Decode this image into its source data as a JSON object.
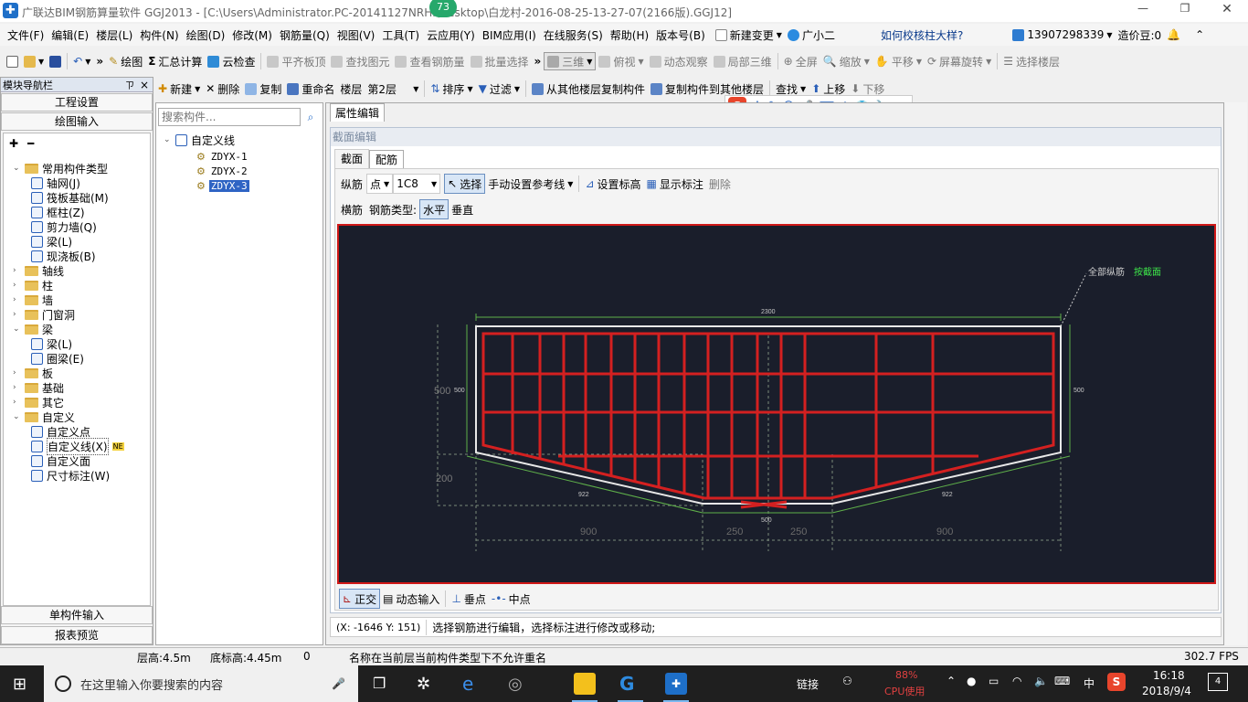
{
  "window": {
    "title": "广联达BIM钢筋算量软件 GGJ2013 - [C:\\Users\\Administrator.PC-20141127NRHI\\Desktop\\白龙村-2016-08-25-13-27-07(2166版).GGJ12]",
    "badge": "73"
  },
  "menu": {
    "items": [
      "文件(F)",
      "编辑(E)",
      "楼层(L)",
      "构件(N)",
      "绘图(D)",
      "修改(M)",
      "钢筋量(Q)",
      "视图(V)",
      "工具(T)",
      "云应用(Y)",
      "BIM应用(I)",
      "在线服务(S)",
      "帮助(H)",
      "版本号(B)"
    ],
    "new_change": "新建变更",
    "guangxiaoer": "广小二",
    "help_link": "如何校核柱大样?",
    "phone": "13907298339",
    "price_bean": "造价豆:0"
  },
  "toolbar1": {
    "draw": "绘图",
    "sum": "汇总计算",
    "cloud_check": "云检查",
    "flat_top": "平齐板顶",
    "find_elem": "查找图元",
    "view_rebar": "查看钢筋量",
    "batch_select": "批量选择",
    "view3d": "三维",
    "topview": "俯视",
    "dynamic": "动态观察",
    "partial3d": "局部三维",
    "fullscreen": "全屏",
    "zoom": "缩放",
    "pan": "平移",
    "rotate": "屏幕旋转",
    "select_floor": "选择楼层"
  },
  "nav": {
    "title": "模块导航栏",
    "pin": "ㄗ",
    "close": "×",
    "project_settings": "工程设置",
    "drawing_input": "绘图输入",
    "single_input": "单构件输入",
    "report": "报表预览",
    "tree": [
      {
        "label": "常用构件类型",
        "level": 0,
        "type": "folder",
        "open": true
      },
      {
        "label": "轴网(J)",
        "level": 1,
        "type": "item"
      },
      {
        "label": "筏板基础(M)",
        "level": 1,
        "type": "item"
      },
      {
        "label": "框柱(Z)",
        "level": 1,
        "type": "item"
      },
      {
        "label": "剪力墙(Q)",
        "level": 1,
        "type": "item"
      },
      {
        "label": "梁(L)",
        "level": 1,
        "type": "item"
      },
      {
        "label": "现浇板(B)",
        "level": 1,
        "type": "item"
      },
      {
        "label": "轴线",
        "level": 0,
        "type": "folder"
      },
      {
        "label": "柱",
        "level": 0,
        "type": "folder"
      },
      {
        "label": "墙",
        "level": 0,
        "type": "folder"
      },
      {
        "label": "门窗洞",
        "level": 0,
        "type": "folder"
      },
      {
        "label": "梁",
        "level": 0,
        "type": "folder",
        "open": true
      },
      {
        "label": "梁(L)",
        "level": 1,
        "type": "item"
      },
      {
        "label": "圈梁(E)",
        "level": 1,
        "type": "item"
      },
      {
        "label": "板",
        "level": 0,
        "type": "folder"
      },
      {
        "label": "基础",
        "level": 0,
        "type": "folder"
      },
      {
        "label": "其它",
        "level": 0,
        "type": "folder"
      },
      {
        "label": "自定义",
        "level": 0,
        "type": "folder",
        "open": true
      },
      {
        "label": "自定义点",
        "level": 1,
        "type": "item"
      },
      {
        "label": "自定义线(X)",
        "level": 1,
        "type": "item",
        "selected": true,
        "badge": "NE"
      },
      {
        "label": "自定义面",
        "level": 1,
        "type": "item"
      },
      {
        "label": "尺寸标注(W)",
        "level": 1,
        "type": "item"
      }
    ]
  },
  "comp_toolbar": {
    "new": "新建",
    "delete": "删除",
    "copy": "复制",
    "rename": "重命名",
    "floor_label": "楼层",
    "floor_value": "第2层",
    "sort": "排序",
    "filter": "过滤",
    "copy_from": "从其他楼层复制构件",
    "copy_to": "复制构件到其他楼层",
    "find": "查找",
    "up": "上移",
    "down": "下移"
  },
  "ime": {
    "s": "S",
    "zh": "中",
    "punct": "°,"
  },
  "components": {
    "search_placeholder": "搜索构件...",
    "root": "自定义线",
    "items": [
      "ZDYX-1",
      "ZDYX-2",
      "ZDYX-3"
    ],
    "selected_index": 2
  },
  "prop_tab": "属性编辑",
  "section_editor": {
    "title": "截面编辑",
    "tabs": [
      "截面",
      "配筋"
    ],
    "active_tab": "配筋",
    "row1": {
      "longitudinal": "纵筋",
      "point": "点",
      "spec": "1C8",
      "select": "选择",
      "manual_ref": "手动设置参考线",
      "set_elev": "设置标高",
      "show_label": "显示标注",
      "delete": "删除"
    },
    "row2": {
      "transverse": "横筋",
      "rebar_type_label": "钢筋类型:",
      "horizontal": "水平",
      "vertical": "垂直"
    },
    "bottom": {
      "ortho": "正交",
      "dynamic_input": "动态输入",
      "perpendicular": "垂点",
      "midpoint": "中点"
    },
    "status": {
      "coords": "(X: -1646 Y: 151)",
      "message": "选择钢筋进行编辑，选择标注进行修改或移动;"
    }
  },
  "canvas": {
    "annotation_all": "全部纵筋",
    "annotation_section": "按截面",
    "dims": {
      "top": "2300",
      "left_h": "500",
      "left_h2": "500",
      "right_h": "500",
      "left_bottom": "200",
      "slant_left": "922",
      "slant_right": "922",
      "bottom_center": "500",
      "bot1": "900",
      "bot2": "250",
      "bot3": "250",
      "bot4": "900"
    }
  },
  "statusbar": {
    "floor_height": "层高:4.5m",
    "bottom_elev": "底标高:4.45m",
    "count": "0",
    "message": "名称在当前层当前构件类型下不允许重名",
    "fps": "302.7 FPS"
  },
  "taskbar": {
    "search": "在这里输入你要搜索的内容",
    "link": "链接",
    "cpu_pct": "88%",
    "cpu_label": "CPU使用",
    "ime": "中",
    "time": "16:18",
    "date": "2018/9/4",
    "notif": "4"
  }
}
